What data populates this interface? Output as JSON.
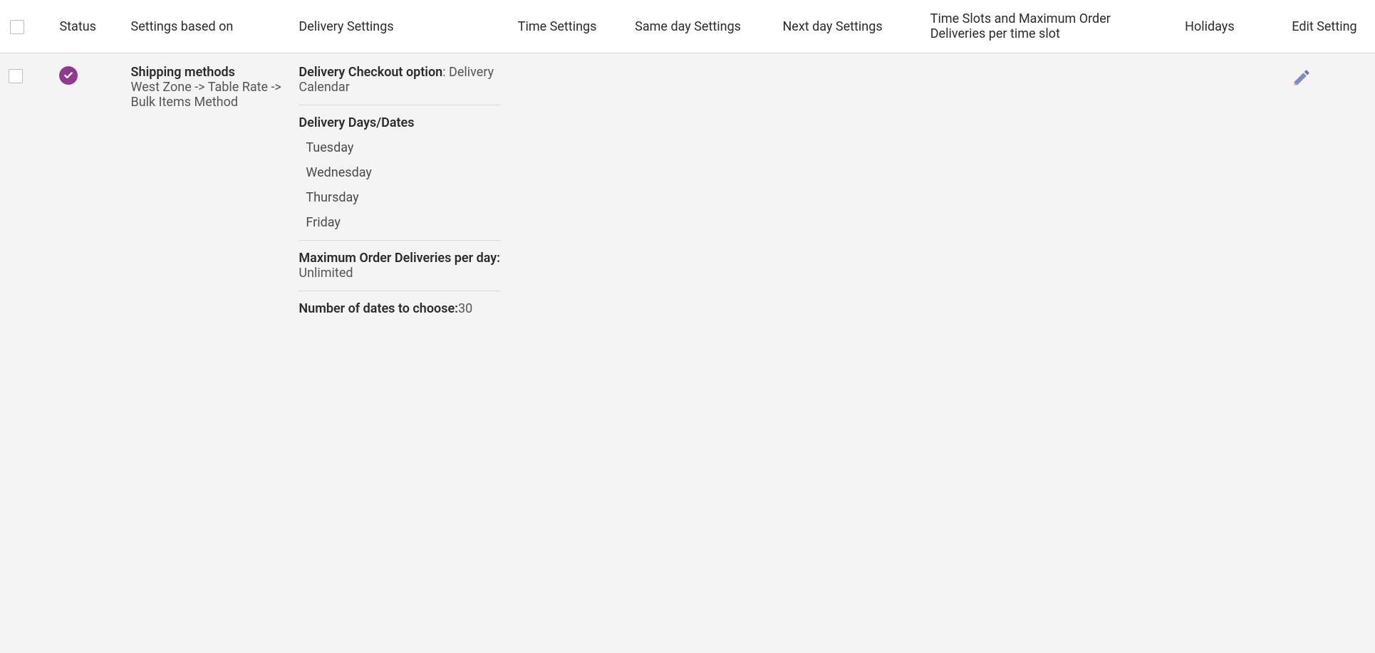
{
  "headers": {
    "status": "Status",
    "settings_based_on": "Settings based on",
    "delivery_settings": "Delivery Settings",
    "time_settings": "Time Settings",
    "same_day_settings": "Same day Settings",
    "next_day_settings": "Next day Settings",
    "time_slots": "Time Slots and Maximum Order Deliveries per time slot",
    "holidays": "Holidays",
    "edit_setting": "Edit Setting"
  },
  "row": {
    "settings_based_on_title": "Shipping methods",
    "settings_based_on_value": "West Zone -> Table Rate -> Bulk Items Method",
    "delivery_checkout_label": "Delivery Checkout option",
    "delivery_checkout_value": ": Delivery Calendar",
    "delivery_days_label": "Delivery Days/Dates",
    "days": {
      "d0": "Tuesday",
      "d1": "Wednesday",
      "d2": "Thursday",
      "d3": "Friday"
    },
    "max_orders_label": "Maximum Order Deliveries per day:",
    "max_orders_value": " Unlimited",
    "number_dates_label": "Number of dates to choose:",
    "number_dates_value": "30"
  }
}
